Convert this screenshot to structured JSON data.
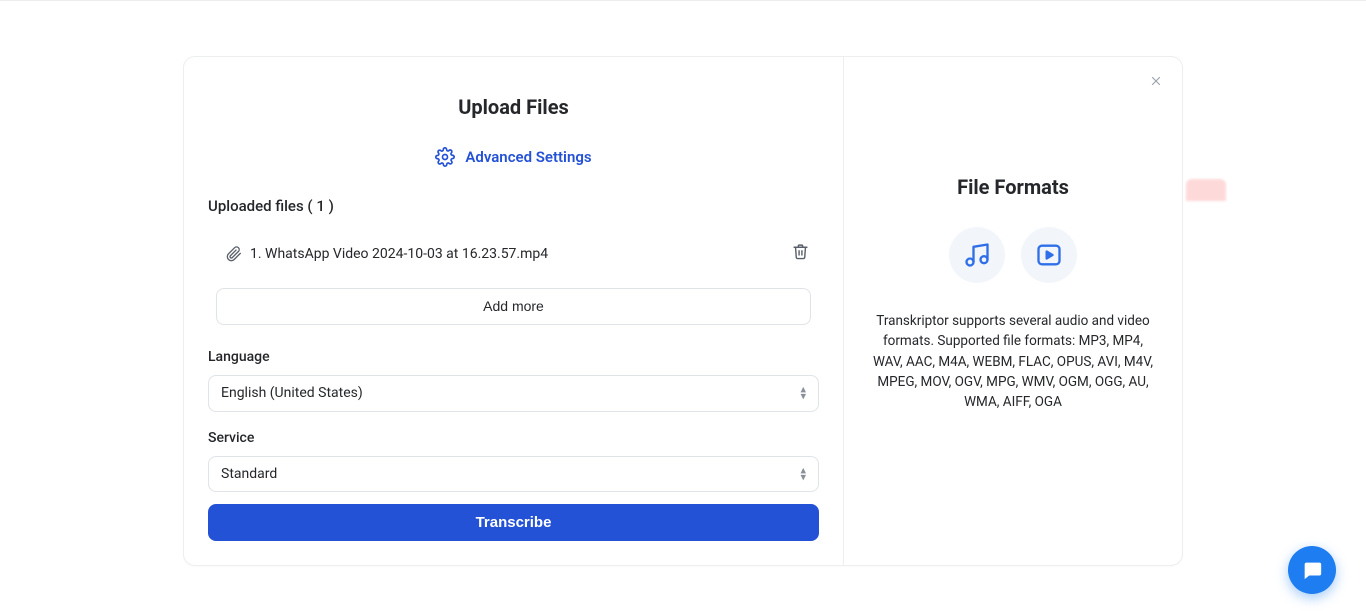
{
  "modal": {
    "title": "Upload Files",
    "advanced_label": "Advanced Settings",
    "uploaded_label": "Uploaded files ( 1 )",
    "file": {
      "display_name": "1. WhatsApp Video 2024-10-03 at 16.23.57.mp4"
    },
    "add_more_label": "Add more",
    "language_label": "Language",
    "language_value": "English (United States)",
    "service_label": "Service",
    "service_value": "Standard",
    "transcribe_label": "Transcribe"
  },
  "side": {
    "title": "File Formats",
    "description": "Transkriptor supports several audio and video formats. Supported file formats: MP3, MP4, WAV, AAC, M4A, WEBM, FLAC, OPUS, AVI, M4V, MPEG, MOV, OGV, MPG, WMV, OGM, OGG, AU, WMA, AIFF, OGA"
  }
}
